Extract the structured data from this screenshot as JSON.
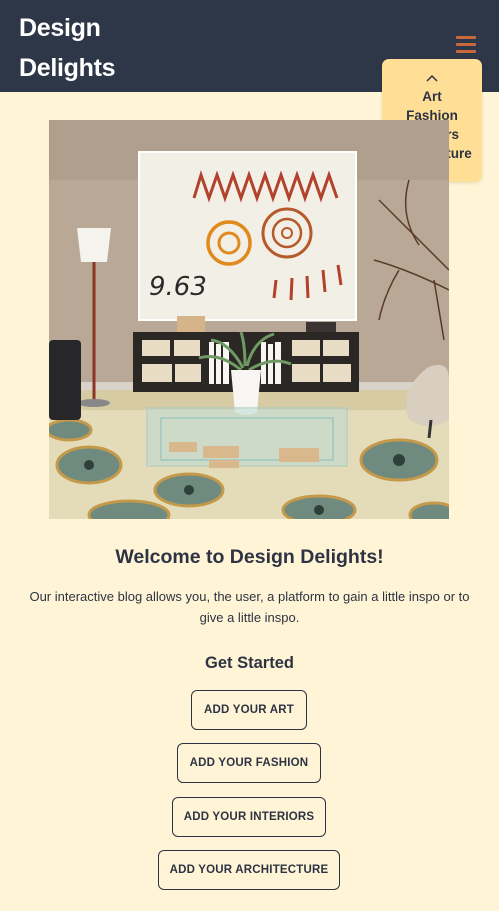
{
  "header": {
    "brand_line1": "Design",
    "brand_line2": "Delights",
    "menu_icon": "hamburger-icon"
  },
  "dropdown": {
    "collapse_icon": "chevron-up-icon",
    "items": [
      "Art",
      "Fashion",
      "Interiors",
      "Architecture"
    ]
  },
  "hero": {
    "artwork_text": "9.63"
  },
  "main": {
    "welcome_title": "Welcome to Design Delights!",
    "intro_text": "Our interactive blog allows you, the user, a platform to gain a little inspo or to give a little inspo.",
    "get_started_heading": "Get Started",
    "buttons": [
      "ADD YOUR ART",
      "ADD YOUR FASHION",
      "ADD YOUR INTERIORS",
      "ADD YOUR ARCHITECTURE"
    ]
  },
  "colors": {
    "page_background": "#fff5d6",
    "navbar": "#2e3748",
    "dropdown": "#ffdf95",
    "accent": "#c9683a",
    "text": "#2e3344"
  }
}
